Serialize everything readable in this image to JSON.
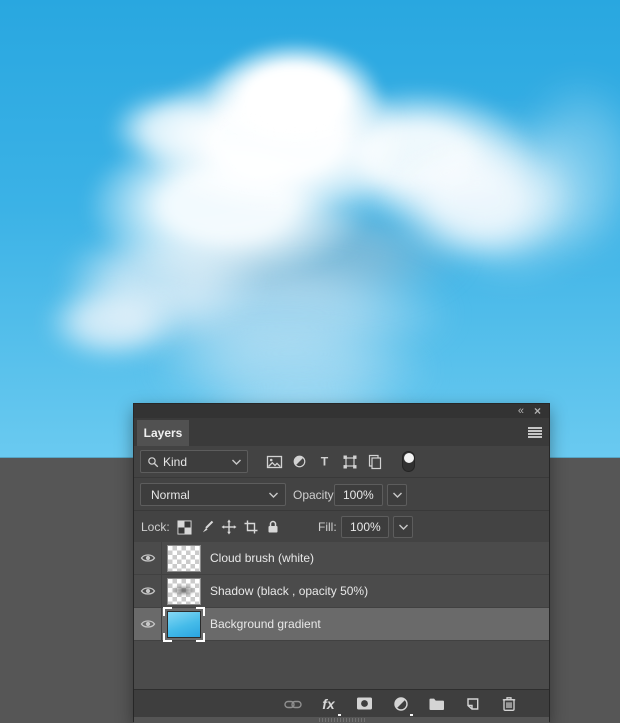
{
  "canvas": {
    "sky_top_color": "#29a7e0",
    "sky_bottom_color": "#6acaf0",
    "pasteboard_color": "#565656"
  },
  "panel": {
    "tab_label": "Layers",
    "titlebar_icons": [
      "collapse-to-icons-icon",
      "close-icon"
    ],
    "collapse_glyph": "«",
    "close_glyph": "×",
    "filter": {
      "combo_value": "Kind",
      "type_glyph": "T",
      "icons": [
        "search-icon",
        "pixel-layer-filter-icon",
        "adjustment-layer-filter-icon",
        "type-layer-filter-icon",
        "shape-layer-filter-icon",
        "smart-object-filter-icon",
        "layer-filter-toggle"
      ]
    },
    "blend": {
      "mode_value": "Normal",
      "opacity_label": "Opacity:",
      "opacity_value": "100%"
    },
    "lock": {
      "label": "Lock:",
      "icons": [
        "lock-transparency-icon",
        "lock-pixels-icon",
        "lock-position-icon",
        "lock-artboard-icon",
        "lock-all-icon"
      ],
      "fill_label": "Fill:",
      "fill_value": "100%"
    },
    "layers": [
      {
        "name": "Cloud brush (white)",
        "visible": true,
        "selected": false,
        "thumb": "transparent-checkerboard"
      },
      {
        "name": "Shadow (black , opacity 50%)",
        "visible": true,
        "selected": false,
        "thumb": "checkerboard-gray-smudge"
      },
      {
        "name": "Background gradient",
        "visible": true,
        "selected": true,
        "thumb": "blue-gradient"
      }
    ],
    "footer": {
      "fx_glyph": "fx",
      "icons": [
        "link-layers-icon",
        "layer-style-icon",
        "add-layer-mask-icon",
        "new-adjustment-layer-icon",
        "new-group-icon",
        "new-layer-icon",
        "delete-layer-icon"
      ]
    }
  }
}
